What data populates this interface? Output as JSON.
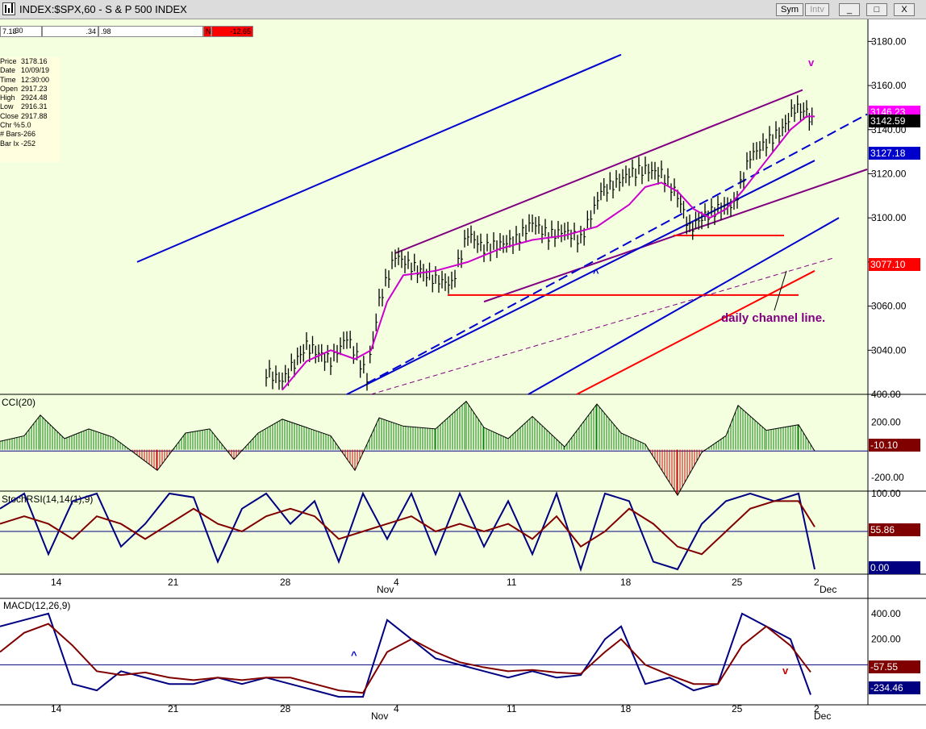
{
  "window": {
    "title": "INDEX:$SPX,60 - S & P 500 INDEX",
    "buttons": {
      "sym": "Sym",
      "intv": "Intv",
      "minimize": "_",
      "maximize": "□",
      "close": "X"
    }
  },
  "status_bar": {
    "cells": [
      "7.18",
      ".30",
      ".34",
      ".98"
    ],
    "flag": "N",
    "change": "-12.65"
  },
  "data_window": [
    {
      "key": "Price",
      "value": "3178.16"
    },
    {
      "key": "Date",
      "value": "10/09/19"
    },
    {
      "key": "Time",
      "value": "12:30:00"
    },
    {
      "key": "Open",
      "value": "2917.23"
    },
    {
      "key": "High",
      "value": "2924.48"
    },
    {
      "key": "Low",
      "value": "2916.31"
    },
    {
      "key": "Close",
      "value": "2917.88"
    },
    {
      "key": "Chr %",
      "value": "5.0"
    },
    {
      "key": "# Bars",
      "value": "-266"
    },
    {
      "key": "Bar Ix",
      "value": "-252"
    }
  ],
  "chart_data": [
    {
      "type": "line",
      "panel": "price",
      "ylim": [
        3020,
        3190
      ],
      "y_ticks": [
        3040,
        3060,
        3080,
        3100,
        3120,
        3140,
        3160,
        3180
      ],
      "x_ticks": [
        "14",
        "21",
        "28",
        "4",
        "11",
        "18",
        "25",
        "2"
      ],
      "x_month_labels": [
        "Nov",
        "Dec"
      ],
      "annotations": [
        "daily channel line.",
        "v",
        "^"
      ],
      "value_tags": [
        {
          "value": "3146.23",
          "color": "#ff00ff"
        },
        {
          "value": "3142.59",
          "color": "#000000"
        },
        {
          "value": "3127.18",
          "color": "#0000cc"
        },
        {
          "value": "3077.10",
          "color": "#ff0000"
        }
      ],
      "series": [
        {
          "name": "",
          "color": "#000000",
          "x": [
            330,
            350,
            380,
            410,
            430,
            455,
            470,
            490,
            510,
            540,
            560,
            580,
            600,
            620,
            640,
            660,
            680,
            700,
            720,
            745,
            760,
            780,
            800,
            820,
            840,
            855,
            870,
            890,
            910,
            930,
            950,
            970,
            985,
            1000,
            1010
          ],
          "values": [
            3030,
            3026,
            3042,
            3035,
            3046,
            3028,
            3062,
            3083,
            3078,
            3072,
            3070,
            3093,
            3086,
            3088,
            3090,
            3098,
            3092,
            3094,
            3090,
            3112,
            3115,
            3120,
            3122,
            3120,
            3110,
            3095,
            3100,
            3104,
            3106,
            3128,
            3134,
            3140,
            3150,
            3148,
            3142
          ]
        },
        {
          "name": "",
          "color": "#cc00cc",
          "x": [
            350,
            380,
            410,
            440,
            460,
            480,
            500,
            540,
            580,
            620,
            660,
            700,
            740,
            780,
            800,
            820,
            840,
            860,
            880,
            900,
            920,
            950,
            980,
            1000,
            1010
          ],
          "values": [
            3022,
            3035,
            3040,
            3036,
            3040,
            3062,
            3074,
            3076,
            3080,
            3086,
            3090,
            3092,
            3096,
            3106,
            3114,
            3116,
            3112,
            3104,
            3100,
            3104,
            3112,
            3126,
            3140,
            3146,
            3146
          ]
        }
      ],
      "lines": [
        {
          "color": "#0000cc",
          "points": [
            [
              3080,
              170
            ],
            [
              3174,
              770
            ]
          ]
        },
        {
          "color": "#800080",
          "points": [
            [
              3084,
              490
            ],
            [
              3158,
              995
            ]
          ]
        },
        {
          "color": "#800080",
          "points": [
            [
              3062,
              600
            ],
            [
              3122,
              1075
            ]
          ]
        },
        {
          "color": "#0000cc",
          "points": [
            [
              3020,
              430
            ],
            [
              3126,
              1010
            ]
          ]
        },
        {
          "color": "#0000cc",
          "points": [
            [
              3020,
              655
            ],
            [
              3100,
              1040
            ]
          ]
        },
        {
          "color": "#ff0000",
          "points": [
            [
              3020,
              715
            ],
            [
              3076,
              1010
            ]
          ]
        },
        {
          "color": "#ff0000",
          "points": [
            [
              3065,
              555
            ],
            [
              3065,
              990
            ]
          ]
        },
        {
          "color": "#ff0000",
          "points": [
            [
              3092,
              835
            ],
            [
              3092,
              972
            ]
          ]
        }
      ]
    },
    {
      "type": "bar",
      "panel": "cci",
      "title": "CCI(20)",
      "ylim": [
        -300,
        400
      ],
      "y_ticks": [
        400,
        200,
        -200
      ],
      "value_tag": "-10.10",
      "x": [
        0,
        30,
        50,
        80,
        110,
        140,
        170,
        195,
        230,
        260,
        290,
        320,
        350,
        380,
        410,
        440,
        470,
        500,
        540,
        578,
        600,
        630,
        660,
        700,
        740,
        770,
        800,
        840,
        870,
        900,
        915,
        950,
        990,
        1010
      ],
      "values": [
        60,
        100,
        250,
        80,
        150,
        90,
        -40,
        -150,
        120,
        150,
        -70,
        120,
        220,
        160,
        100,
        -150,
        230,
        170,
        150,
        350,
        160,
        80,
        240,
        20,
        330,
        120,
        40,
        -330,
        -20,
        100,
        320,
        140,
        180,
        -10
      ]
    },
    {
      "type": "line",
      "panel": "stochrsi",
      "title": "StochRSI(14,14(1),9)",
      "ylim": [
        0,
        100
      ],
      "y_ticks": [
        100,
        0
      ],
      "value_tags": [
        "55.86",
        "0.00"
      ],
      "series": [
        {
          "name": "",
          "color": "#000080",
          "x": [
            0,
            30,
            60,
            90,
            120,
            150,
            180,
            210,
            240,
            270,
            300,
            330,
            360,
            390,
            420,
            450,
            480,
            510,
            540,
            570,
            600,
            630,
            660,
            690,
            720,
            750,
            780,
            810,
            840,
            870,
            900,
            930,
            960,
            990,
            1010
          ],
          "values": [
            80,
            100,
            20,
            90,
            100,
            30,
            60,
            100,
            95,
            10,
            80,
            100,
            60,
            90,
            10,
            100,
            40,
            100,
            20,
            100,
            30,
            90,
            20,
            100,
            0,
            100,
            90,
            10,
            0,
            60,
            90,
            100,
            90,
            100,
            0
          ]
        },
        {
          "name": "",
          "color": "#800000",
          "x": [
            0,
            30,
            60,
            90,
            120,
            150,
            180,
            210,
            240,
            270,
            300,
            330,
            360,
            390,
            420,
            450,
            480,
            510,
            540,
            570,
            600,
            630,
            660,
            690,
            720,
            750,
            780,
            810,
            840,
            870,
            900,
            930,
            960,
            990,
            1010
          ],
          "values": [
            60,
            70,
            60,
            40,
            70,
            60,
            40,
            60,
            80,
            60,
            50,
            70,
            80,
            70,
            40,
            50,
            60,
            70,
            50,
            60,
            50,
            60,
            40,
            70,
            30,
            50,
            80,
            60,
            30,
            20,
            50,
            80,
            90,
            90,
            56
          ]
        }
      ]
    },
    {
      "type": "line",
      "panel": "macd",
      "title": "MACD(12,26,9)",
      "ylim": [
        -300,
        500
      ],
      "y_ticks": [
        400,
        200,
        0
      ],
      "value_tags": [
        "-57.55",
        "-234.46"
      ],
      "annotations": [
        "^",
        "v"
      ],
      "series": [
        {
          "name": "",
          "color": "#000080",
          "x": [
            0,
            30,
            60,
            90,
            120,
            150,
            180,
            210,
            240,
            270,
            300,
            330,
            360,
            390,
            420,
            450,
            480,
            510,
            540,
            570,
            600,
            630,
            660,
            690,
            720,
            750,
            770,
            800,
            830,
            860,
            890,
            920,
            950,
            980,
            1005
          ],
          "values": [
            300,
            350,
            400,
            -150,
            -200,
            -50,
            -100,
            -150,
            -150,
            -100,
            -150,
            -100,
            -150,
            -200,
            -250,
            -250,
            350,
            200,
            50,
            0,
            -50,
            -100,
            -50,
            -100,
            -80,
            200,
            300,
            -150,
            -100,
            -200,
            -150,
            400,
            300,
            200,
            -234
          ]
        },
        {
          "name": "",
          "color": "#800000",
          "x": [
            0,
            30,
            60,
            90,
            120,
            150,
            180,
            210,
            240,
            270,
            300,
            330,
            360,
            390,
            420,
            450,
            480,
            510,
            540,
            570,
            600,
            630,
            660,
            690,
            720,
            750,
            770,
            800,
            830,
            860,
            890,
            920,
            950,
            980,
            1005
          ],
          "values": [
            100,
            250,
            320,
            150,
            -50,
            -80,
            -60,
            -100,
            -120,
            -100,
            -120,
            -100,
            -100,
            -150,
            -200,
            -220,
            100,
            200,
            100,
            20,
            -20,
            -50,
            -40,
            -60,
            -70,
            100,
            200,
            0,
            -80,
            -150,
            -150,
            150,
            300,
            150,
            -57
          ]
        }
      ]
    }
  ]
}
